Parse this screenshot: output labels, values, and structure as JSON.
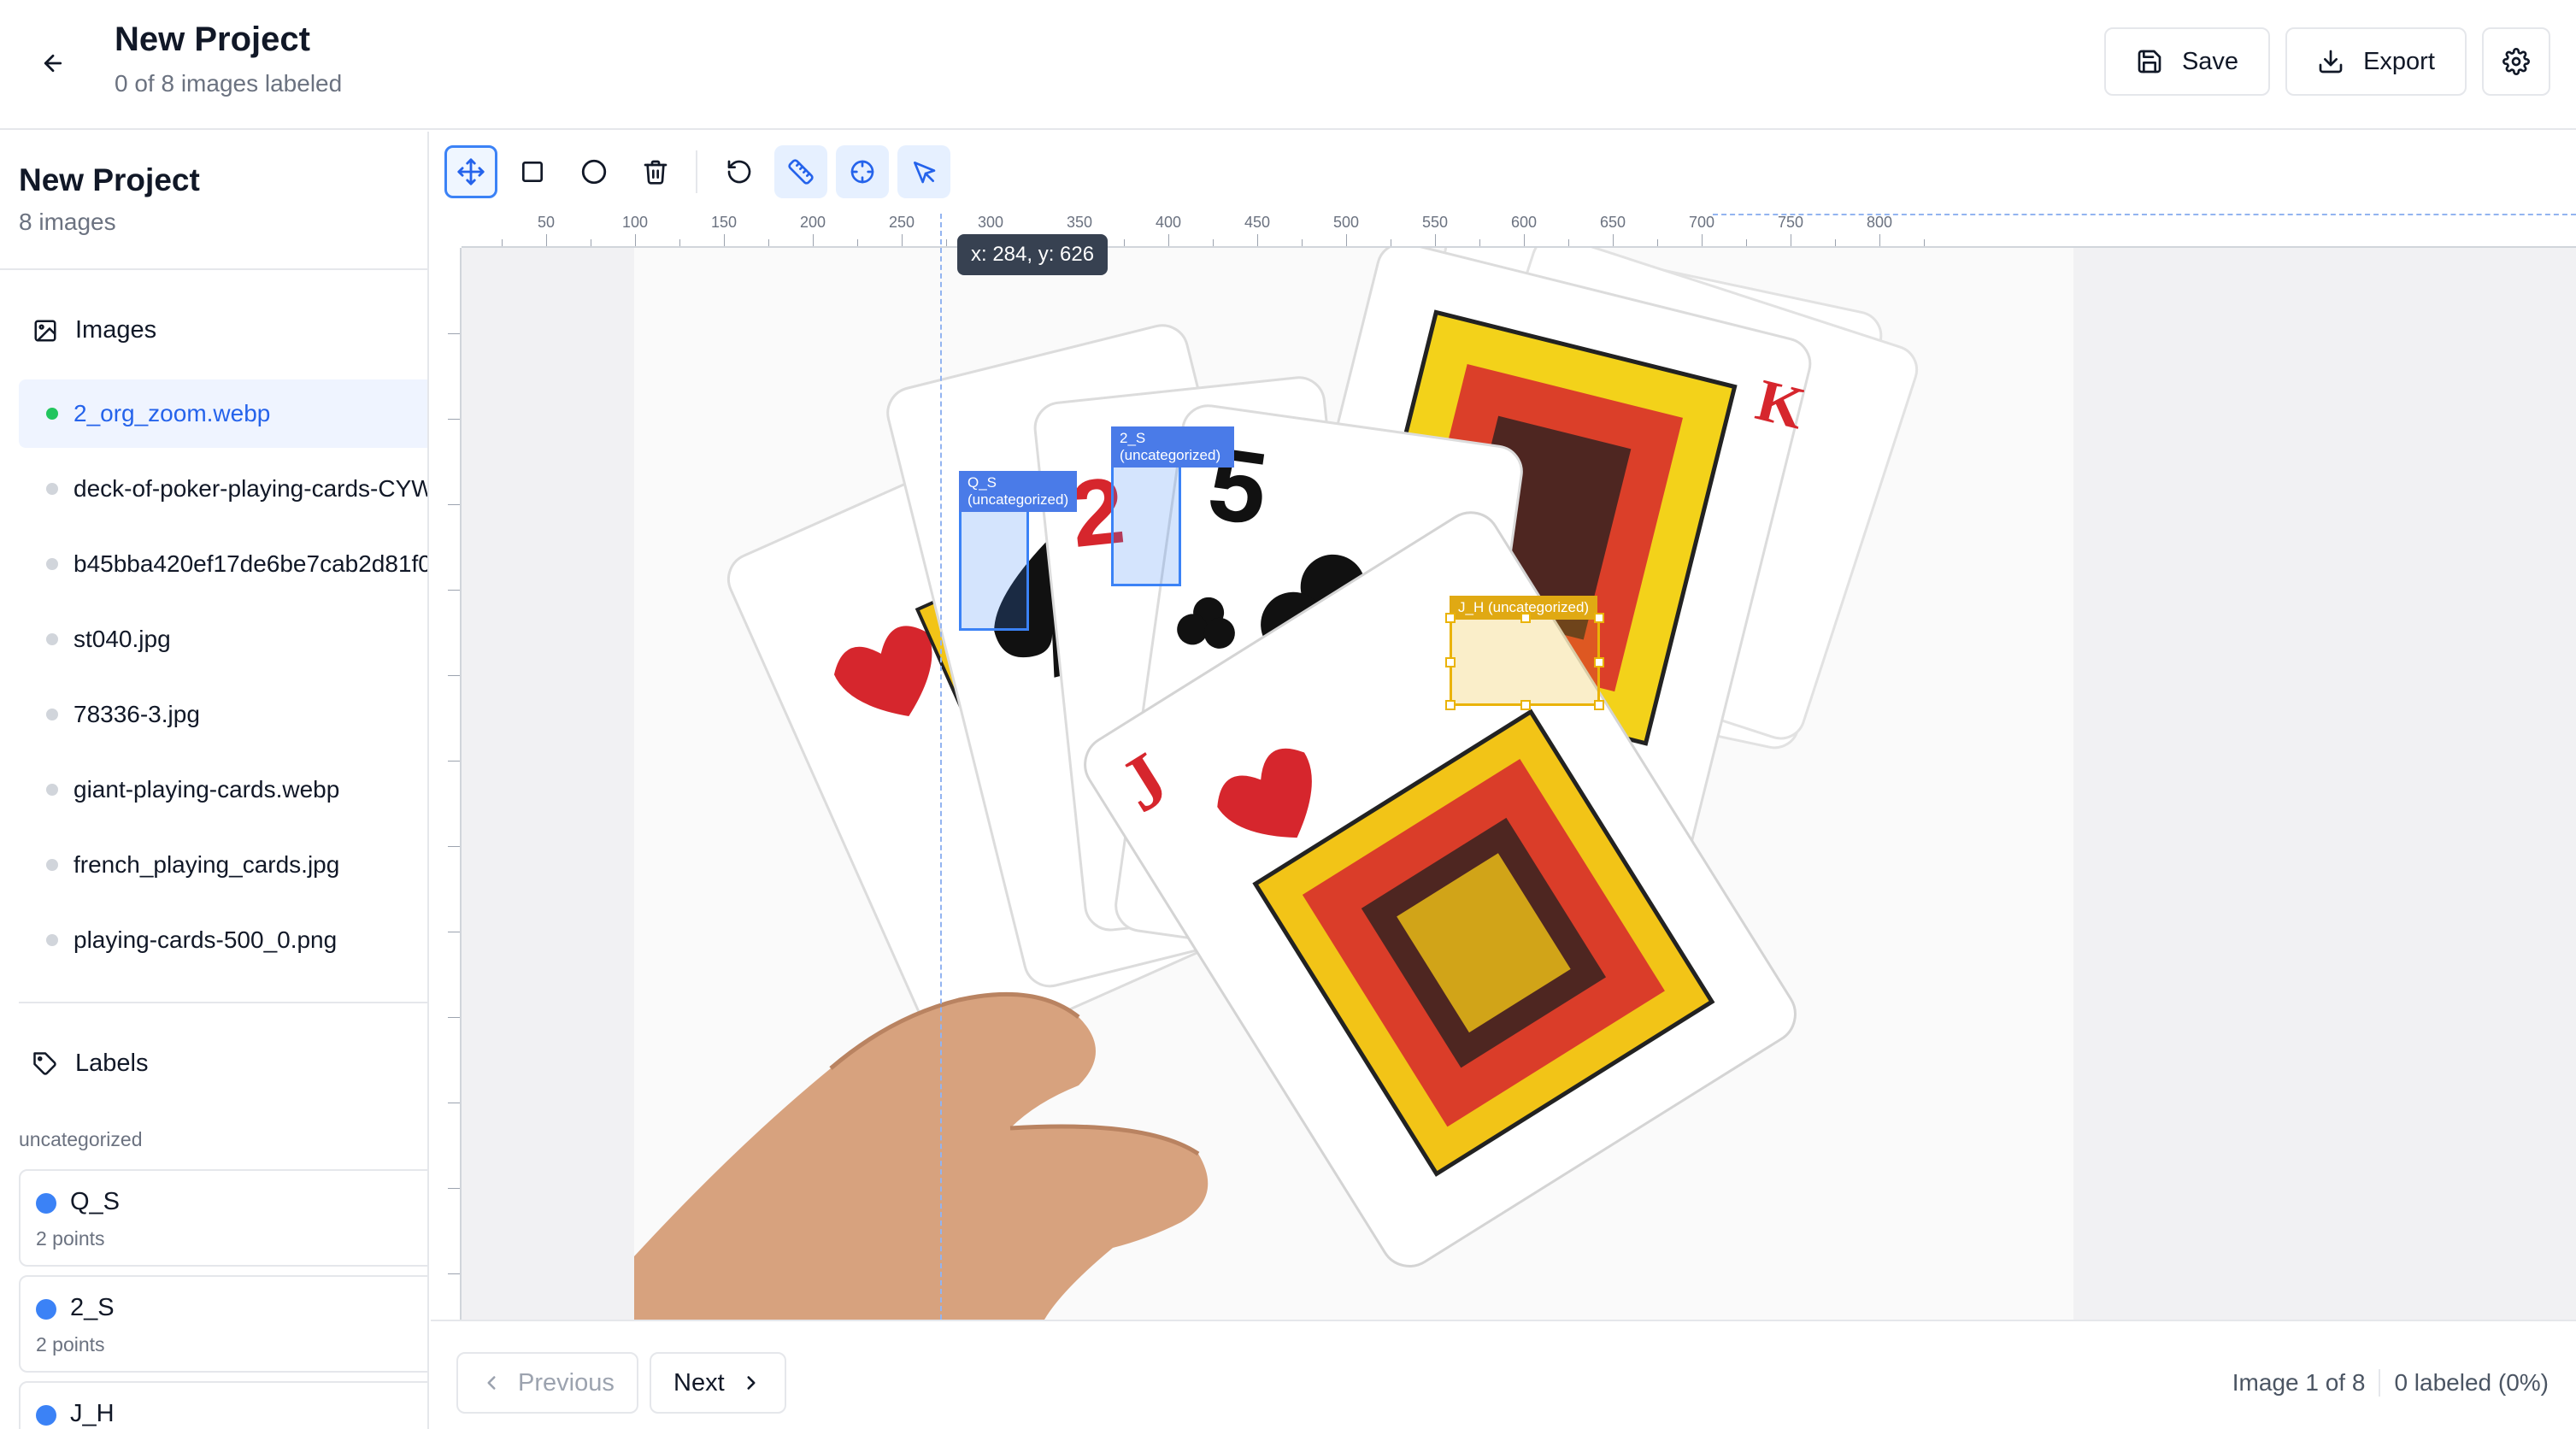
{
  "header": {
    "title": "New Project",
    "subtitle": "0 of 8 images labeled",
    "save_label": "Save",
    "export_label": "Export"
  },
  "sidebar": {
    "project_title": "New Project",
    "image_count": "8 images",
    "images_heading": "Images",
    "images": [
      {
        "name": "2_org_zoom.webp",
        "active": true
      },
      {
        "name": "deck-of-poker-playing-cards-CYW",
        "active": false
      },
      {
        "name": "b45bba420ef17de6be7cab2d81f0",
        "active": false
      },
      {
        "name": "st040.jpg",
        "active": false
      },
      {
        "name": "78336-3.jpg",
        "active": false
      },
      {
        "name": "giant-playing-cards.webp",
        "active": false
      },
      {
        "name": "french_playing_cards.jpg",
        "active": false
      },
      {
        "name": "playing-cards-500_0.png",
        "active": false
      }
    ],
    "labels_heading": "Labels",
    "category": "uncategorized",
    "labels": [
      {
        "name": "Q_S",
        "points": "2 points",
        "color": "#3b82f6"
      },
      {
        "name": "2_S",
        "points": "2 points",
        "color": "#3b82f6"
      },
      {
        "name": "J_H",
        "points": "",
        "color": "#3b82f6"
      }
    ]
  },
  "toolbar": {
    "tools": [
      "move-icon",
      "rectangle-icon",
      "circle-icon",
      "trash-icon",
      "undo-icon",
      "ruler-icon",
      "crosshair-icon",
      "pointer-icon"
    ]
  },
  "canvas": {
    "ruler_ticks": [
      "50",
      "100",
      "150",
      "200",
      "250",
      "300",
      "350",
      "400",
      "450",
      "500",
      "550",
      "600",
      "650",
      "700",
      "750",
      "800"
    ],
    "coord_readout": "x: 284, y: 626",
    "annotations": [
      {
        "id": "q_s",
        "tag_line1": "Q_S",
        "tag_line2": "(uncategorized)",
        "color": "#3b82f6"
      },
      {
        "id": "two_s",
        "tag_line1": "2_S",
        "tag_line2": "(uncategorized)",
        "color": "#3b82f6"
      },
      {
        "id": "j_h",
        "tag_line1": "J_H (uncategorized)",
        "tag_line2": "",
        "color": "#eab308"
      }
    ]
  },
  "footer": {
    "previous_label": "Previous",
    "next_label": "Next",
    "image_position": "Image 1 of 8",
    "labeled_status": "0 labeled (0%)"
  },
  "colors": {
    "accent": "#3b82f6",
    "active_dot": "#22c55e",
    "highlight_box": "#eab308"
  }
}
